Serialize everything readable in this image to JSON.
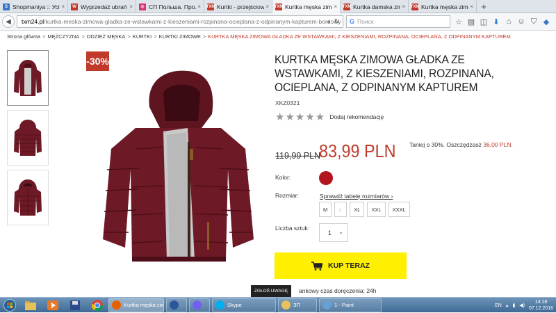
{
  "browser": {
    "tabs": [
      {
        "title": "Shopmaniya :: Усі ...",
        "fav_color": "#3b78c4",
        "fav_text": "S",
        "active": false
      },
      {
        "title": "Wyprzedaż ubrań i ...",
        "fav_color": "#c0392b",
        "fav_text": "W",
        "active": false
      },
      {
        "title": "СП Польша. Про...",
        "fav_color": "#d6336c",
        "fav_text": "◎",
        "active": false
      },
      {
        "title": "Kurtki - przejściow...",
        "fav_color": "#c0392b",
        "fav_text": "TXM",
        "active": false
      },
      {
        "title": "Kurtka męska zimo...",
        "fav_color": "#c0392b",
        "fav_text": "TXM",
        "active": true
      },
      {
        "title": "Kurtka damska zim...",
        "fav_color": "#c0392b",
        "fav_text": "TXM",
        "active": false
      },
      {
        "title": "Kurtka męska zimo...",
        "fav_color": "#c0392b",
        "fav_text": "TXM",
        "active": false
      }
    ],
    "new_tab": "+",
    "url_host": "txm24.pl",
    "url_path": "/kurtka-meska-zimowa-gladka-ze-wstawkami-z-kieszeniami-rozpinana-ocieplana-z-odpinanym-kapturem-bordowy",
    "search_placeholder": "Поиск"
  },
  "breadcrumb": {
    "items": [
      "Strona główna",
      "MĘŻCZYZNA",
      "ODZIEŻ MĘSKA",
      "KURTKI",
      "KURTKI ZIMOWE"
    ],
    "current": "KURTKA MĘSKA ZIMOWA GŁADKA ZE WSTAWKAMI, Z KIESZENIAMI, ROZPINANA, OCIEPLANA, Z ODPINANYM KAPTUREM",
    "separator": ">"
  },
  "product": {
    "badge": "-30%",
    "title": "KURTKA MĘSKA ZIMOWA GŁADKA ZE WSTAWKAMI, Z KIESZENIAMI, ROZPINANA, OCIEPLANA, Z ODPINANYM KAPTUREM",
    "sku": "XKZ0321",
    "stars": "★★★★★",
    "rating_link": "Dodaj rekomendację",
    "old_price": "119,99 PLN",
    "new_price": "83,99 PLN",
    "discount_text": "Taniej o 30%. Oszczędzasz",
    "discount_amount": "36,00 PLN.",
    "color_label": "Kolor:",
    "color_value": "#b3141d",
    "size_label": "Rozmiar:",
    "size_chart_link": "Sprawdź tabelę rozmiarów ›",
    "sizes": [
      "M",
      "L",
      "XL",
      "XXL",
      "XXXL"
    ],
    "qty_label": "Liczba sztuk:",
    "qty_value": "1",
    "buy_label": "KUP TERAZ",
    "delivery": "ankowy czas doręczenia: 24h",
    "report_label": "ZGŁOŚ UWAGĘ",
    "jacket_color": "#6e1a26"
  },
  "taskbar": {
    "tasks": [
      {
        "label": "Kurtka męska zimo...",
        "active": true
      },
      {
        "label": "",
        "active": false
      },
      {
        "label": "",
        "active": false
      },
      {
        "label": "Skype",
        "active": false
      },
      {
        "label": "ЗП",
        "active": false
      },
      {
        "label": "1 - Paint",
        "active": false
      }
    ],
    "lang": "EN",
    "time": "14:18",
    "date": "07.12.2016"
  }
}
